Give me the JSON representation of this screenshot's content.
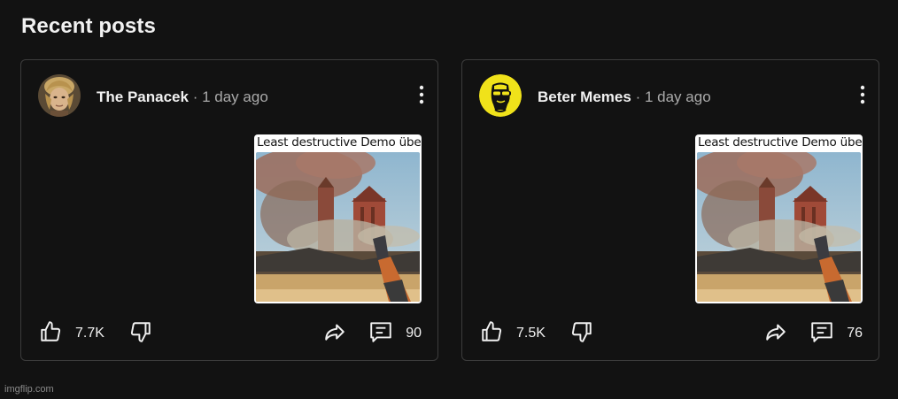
{
  "section": {
    "title": "Recent posts"
  },
  "posts": [
    {
      "author": "The Panacek",
      "separator": "·",
      "time": "1 day ago",
      "thumbnail_caption": "Least destructive Demo über:",
      "likes": "7.7K",
      "comments": "90",
      "avatar_icon": "person-portrait-icon"
    },
    {
      "author": "Beter Memes",
      "separator": "·",
      "time": "1 day ago",
      "thumbnail_caption": "Least destructive Demo über:",
      "likes": "7.5K",
      "comments": "76",
      "avatar_icon": "sunglasses-face-logo-icon"
    }
  ],
  "watermark": "imgflip.com",
  "colors": {
    "background": "#121212",
    "card_border": "#3c3c3c",
    "text_primary": "#f1f1f1",
    "text_secondary": "#aaaaaa",
    "brand_yellow": "#f0e21a"
  }
}
